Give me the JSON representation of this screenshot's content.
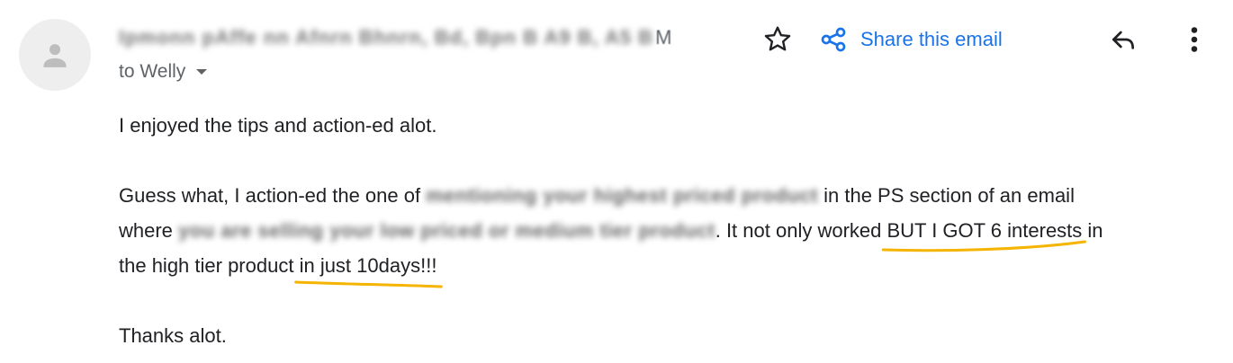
{
  "header": {
    "sender_blurred": "Ipmonn pAffe nn Afnrn Bhnrn, Bd, Bpn B A9 B, A5 B",
    "sender_suffix": "M",
    "to_label": "to Welly",
    "share_label": "Share this email"
  },
  "icons": {
    "avatar": "person-avatar-icon",
    "star": "star-outline-icon",
    "share": "share-icon",
    "reply": "reply-icon",
    "more": "more-vert-icon",
    "dropdown": "dropdown-arrow-icon"
  },
  "colors": {
    "accent_blue": "#1a73e8",
    "highlight_underline": "#f5b400",
    "text_primary": "#202124",
    "text_secondary": "#5f6368"
  },
  "message": {
    "p1": "I enjoyed the tips and action-ed alot.",
    "p2_a": "Guess what, I action-ed the one of ",
    "p2_blur1": "mentioning your highest priced product",
    "p2_b": " in the PS section of an email",
    "p2_c": "where ",
    "p2_blur2": "you are selling your low priced or medium tier product",
    "p2_d": ". It not only worked ",
    "p2_hl1": "BUT I GOT 6 interests",
    "p2_e": " in",
    "p2_f": "the high tier product ",
    "p2_hl2": "in just 10days!!!",
    "p3": "Thanks alot."
  }
}
